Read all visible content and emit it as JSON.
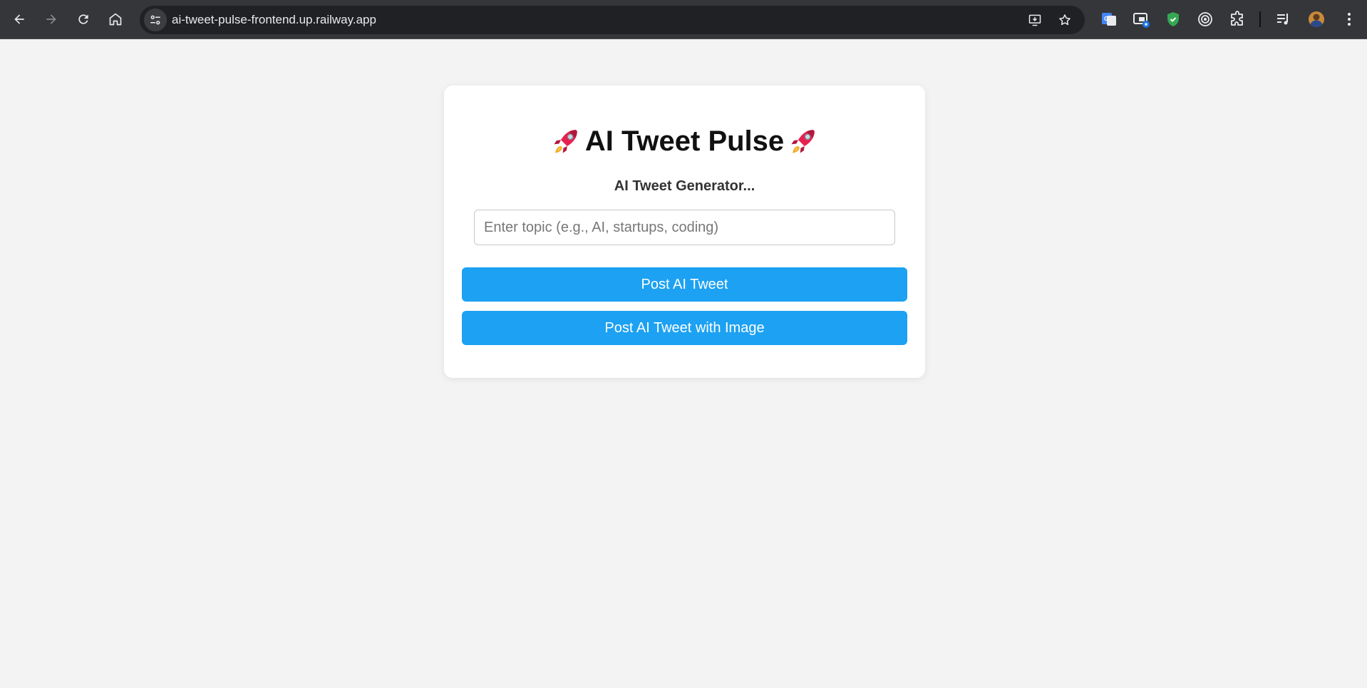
{
  "browser": {
    "url": "ai-tweet-pulse-frontend.up.railway.app",
    "nav_icons": [
      "back-arrow-icon",
      "forward-arrow-icon",
      "reload-icon",
      "home-icon"
    ],
    "omnibox_icons": [
      "install-app-icon",
      "bookmark-star-icon"
    ],
    "extensions": [
      "google-translate-icon",
      "picture-in-picture-icon",
      "shield-extension-icon",
      "target-extension-icon",
      "puzzle-extensions-icon",
      "media-controls-icon",
      "profile-avatar",
      "more-menu-icon"
    ]
  },
  "app": {
    "title": "AI Tweet Pulse",
    "title_icon": "rocket-emoji",
    "subtitle": "AI Tweet Generator...",
    "topic_input": {
      "value": "",
      "placeholder": "Enter topic (e.g., AI, startups, coding)"
    },
    "buttons": {
      "post_tweet": "Post AI Tweet",
      "post_tweet_image": "Post AI Tweet with Image"
    }
  },
  "colors": {
    "page_background": "#f3f3f3",
    "card_background": "#ffffff",
    "button_primary": "#1da1f2",
    "toolbar": "#35363a"
  }
}
